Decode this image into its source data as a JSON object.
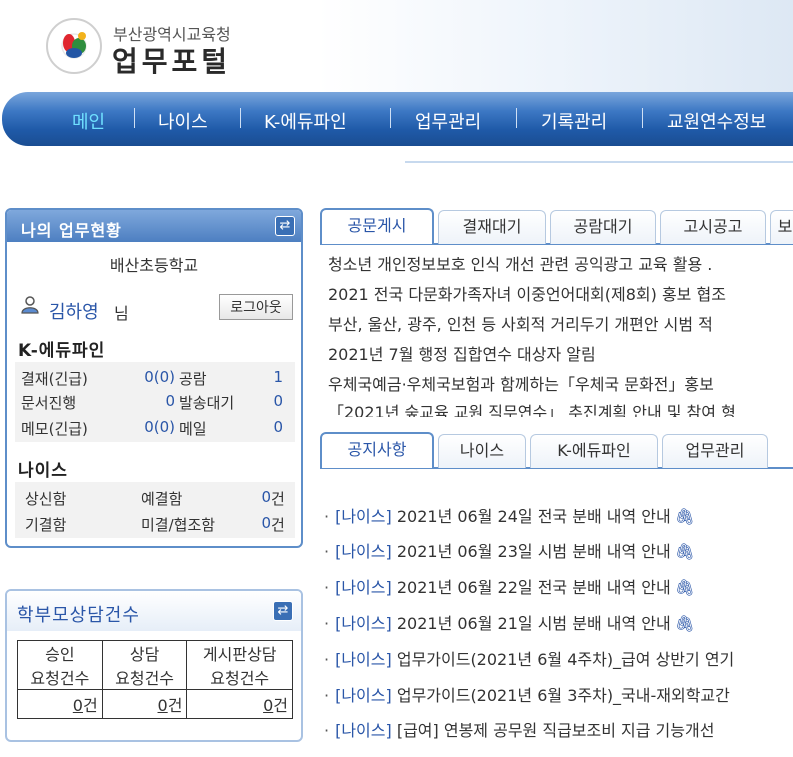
{
  "header": {
    "org_name": "부산광역시교육청",
    "portal_name": "업무포털"
  },
  "nav": {
    "items": [
      "메인",
      "나이스",
      "K-에듀파인",
      "업무관리",
      "기록관리",
      "교원연수정보"
    ],
    "active_index": 0
  },
  "status_box": {
    "title": "나의 업무현황",
    "school": "배산초등학교",
    "user_name": "김하영",
    "user_suffix": "님",
    "logout_label": "로그아웃",
    "edufine": {
      "title": "K-에듀파인",
      "rows": [
        {
          "label": "결재(긴급)",
          "value": "0(0)",
          "label2": "공람",
          "value2": "1"
        },
        {
          "label": "문서진행",
          "value": "0",
          "label2": "발송대기",
          "value2": "0"
        },
        {
          "label": "메모(긴급)",
          "value": "0(0)",
          "label2": "메일",
          "value2": "0"
        }
      ]
    },
    "neis": {
      "title": "나이스",
      "rows": [
        {
          "label": "상신함",
          "label2": "예결함",
          "value2": "0",
          "unit": "건"
        },
        {
          "label": "기결함",
          "label2": "미결/협조함",
          "value2": "0",
          "unit": "건"
        }
      ]
    }
  },
  "counsel_box": {
    "title": "학부모상담건수",
    "headers": [
      [
        "승인",
        "요청건수"
      ],
      [
        "상담",
        "요청건수"
      ],
      [
        "게시판상담",
        "요청건수"
      ]
    ],
    "counts": [
      "0",
      "0",
      "0"
    ],
    "unit": "건"
  },
  "doc_tabs": {
    "labels": [
      "공문게시",
      "결재대기",
      "공람대기",
      "고시공고",
      "보"
    ],
    "active_index": 0
  },
  "doc_list": [
    "청소년 개인정보보호 인식 개선 관련 공익광고 교육 활용 .",
    "2021 전국 다문화가족자녀 이중언어대회(제8회) 홍보 협조",
    "부산, 울산, 광주, 인천 등 사회적 거리두기 개편안 시범 적",
    "2021년 7월 행정 집합연수 대상자 알림",
    "우체국예금·우체국보험과 함께하는「우체국 문화전」홍보",
    "「2021년 숲교육 교원 직무연수」 추진계획 안내 및 참여 형"
  ],
  "notice_tabs": {
    "labels": [
      "공지사항",
      "나이스",
      "K-에듀파인",
      "업무관리"
    ],
    "active_index": 0
  },
  "notice_list": [
    {
      "category": "[나이스]",
      "text": "2021년 06월 24일 전국 분배 내역 안내",
      "attachment": true
    },
    {
      "category": "[나이스]",
      "text": "2021년 06월 23일 시범 분배 내역 안내",
      "attachment": true
    },
    {
      "category": "[나이스]",
      "text": "2021년 06월 22일 전국 분배 내역 안내",
      "attachment": true
    },
    {
      "category": "[나이스]",
      "text": "2021년 06월 21일 시범 분배 내역 안내",
      "attachment": true
    },
    {
      "category": "[나이스]",
      "text": "업무가이드(2021년 6월 4주차)_급여 상반기 연기",
      "attachment": false
    },
    {
      "category": "[나이스]",
      "text": "업무가이드(2021년 6월 3주차)_국내-재외학교간",
      "attachment": false
    },
    {
      "category": "[나이스]",
      "text": "[급여] 연봉제 공무원 직급보조비 지급 기능개선",
      "attachment": false
    }
  ],
  "icons": {
    "refresh": "refresh-icon",
    "user": "user-icon",
    "attachment": "paperclip-icon"
  },
  "colors": {
    "nav_bg": "#1f5aa8",
    "nav_active": "#6fe0ff",
    "link_blue": "#2a56a8",
    "box_border": "#5e8ec9"
  }
}
